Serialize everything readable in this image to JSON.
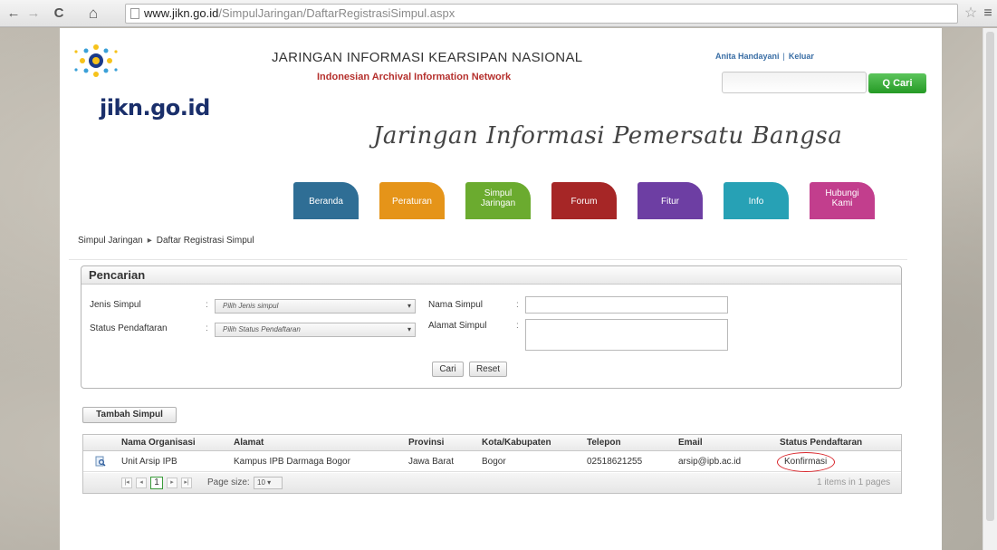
{
  "browser": {
    "url_domain": "www.jikn.go.id",
    "url_path": "/SimpulJaringan/DaftarRegistrasiSimpul.aspx",
    "back_glyph": "←",
    "forward_glyph": "→",
    "reload_glyph": "C",
    "home_glyph": "⌂",
    "star_glyph": "☆",
    "menu_glyph": "≡"
  },
  "header": {
    "logo_text": "jikn.go.id",
    "site_title": "JARINGAN INFORMASI KEARSIPAN NASIONAL",
    "site_subtitle": "Indonesian Archival Information Network",
    "tagline": "Jaringan Informasi Pemersatu Bangsa",
    "user_name": "Anita Handayani",
    "logout_label": "Keluar",
    "separator": "|",
    "search_button": "Q Cari"
  },
  "menu": {
    "tabs": [
      {
        "label": "Beranda",
        "color": "#2f6e95"
      },
      {
        "label": "Peraturan",
        "color": "#e59419"
      },
      {
        "label": "Simpul\nJaringan",
        "color": "#6bab2f"
      },
      {
        "label": "Forum",
        "color": "#a62626"
      },
      {
        "label": "Fitur",
        "color": "#6d3ea3"
      },
      {
        "label": "Info",
        "color": "#27a1b5"
      },
      {
        "label": "Hubungi\nKami",
        "color": "#c23e8d"
      }
    ]
  },
  "breadcrumb": {
    "parent": "Simpul Jaringan",
    "arrow": "▸",
    "current": "Daftar Registrasi Simpul"
  },
  "search": {
    "title": "Pencarian",
    "jenis_label": "Jenis Simpul",
    "jenis_placeholder": "Pilih Jenis simpul",
    "status_label": "Status Pendaftaran",
    "status_placeholder": "Pilih Status Pendaftaran",
    "nama_label": "Nama Simpul",
    "alamat_label": "Alamat Simpul",
    "colon": ":",
    "caret": "▾",
    "cari_button": "Cari",
    "reset_button": "Reset"
  },
  "add_button": "Tambah Simpul",
  "table": {
    "columns": [
      "Nama Organisasi",
      "Alamat",
      "Provinsi",
      "Kota/Kabupaten",
      "Telepon",
      "Email",
      "Status Pendaftaran"
    ],
    "rows": [
      {
        "nama": "Unit Arsip IPB",
        "alamat": "Kampus IPB Darmaga Bogor",
        "provinsi": "Jawa Barat",
        "kota": "Bogor",
        "telepon": "02518621255",
        "email": "arsip@ipb.ac.id",
        "status": "Konfirmasi"
      }
    ],
    "footer": {
      "first": "|◂",
      "prev": "◂",
      "current_page": "1",
      "next": "▸",
      "last": "▸|",
      "page_size_label": "Page size:",
      "page_size": "10",
      "summary": "1 items in 1 pages"
    }
  },
  "colors": {
    "highlight_circle": "#d8242a",
    "search_button": "#259a25",
    "subtitle": "#b5302d"
  }
}
